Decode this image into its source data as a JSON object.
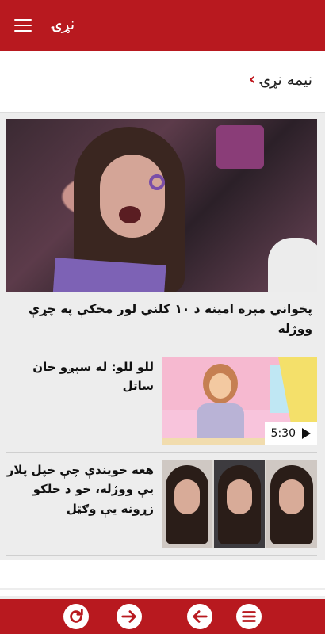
{
  "header": {
    "title": "نړۍ"
  },
  "section": {
    "title": "نیمه نړۍ"
  },
  "hero": {
    "caption": "پخواني مېره امينه د ۱۰ کلني لور مخکې په چړې ووژله"
  },
  "stories": [
    {
      "title": "للو للو: له سپږو خان ساتل",
      "duration": "5:30",
      "media": "video"
    },
    {
      "title": "هغه خويندې چې خپل پلار يې ووژله، خو د خلکو زړونه يې وګټل",
      "media": "photo"
    }
  ],
  "bottom_nav": [
    {
      "name": "refresh",
      "icon": "refresh-icon"
    },
    {
      "name": "forward",
      "icon": "arrow-right-icon"
    },
    {
      "name": "back",
      "icon": "arrow-left-icon"
    },
    {
      "name": "menu",
      "icon": "menu-icon"
    }
  ],
  "colors": {
    "brand": "#b8191f",
    "chevron": "#c0181e",
    "background": "#ededed"
  }
}
